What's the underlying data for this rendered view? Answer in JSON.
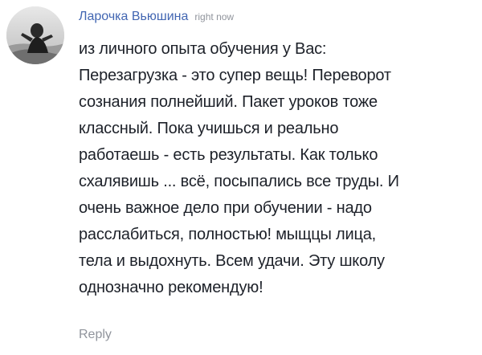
{
  "comment": {
    "author": "Ларочка Вьюшина",
    "timestamp": "right now",
    "avatar_icon": "user-photo-avatar",
    "text_lines": [
      "из личного опыта обучения у Вас:",
      "Перезагрузка - это супер вещь! Переворот",
      "сознания полнейший. Пакет уроков тоже",
      "классный. Пока учишься и реально",
      "работаешь - есть результаты. Как только",
      "схалявишь ... всё, посыпались все труды. И",
      "очень важное дело при обучении - надо",
      "расслабиться, полностью! мыщцы лица,",
      "тела и выдохнуть. Всем удачи. Эту школу",
      "однозначно рекомендую!"
    ],
    "reply_label": "Reply"
  },
  "colors": {
    "author_link": "#4266b2",
    "meta_text": "#90949c",
    "body_text": "#1d2129"
  }
}
